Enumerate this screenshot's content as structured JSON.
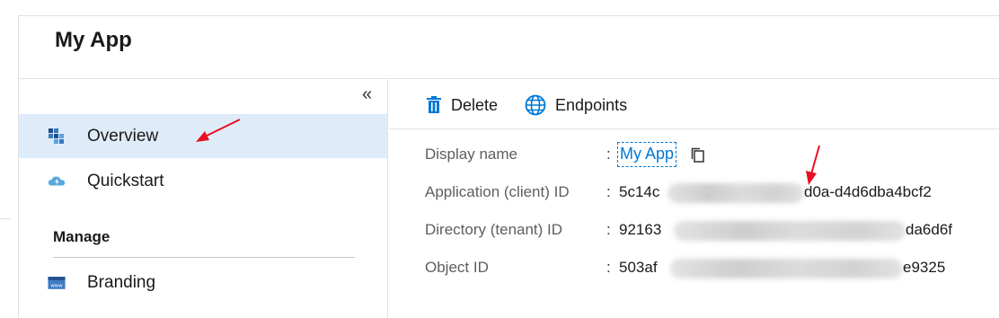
{
  "header": {
    "title": "My App"
  },
  "sidebar": {
    "collapse_glyph": "«",
    "items": [
      {
        "label": "Overview",
        "icon": "grid-cube-icon",
        "selected": true
      },
      {
        "label": "Quickstart",
        "icon": "cloud-lightning-icon",
        "selected": false
      }
    ],
    "manage_section": {
      "title": "Manage",
      "items": [
        {
          "label": "Branding",
          "icon": "www-window-icon"
        }
      ]
    }
  },
  "toolbar": {
    "delete_label": "Delete",
    "endpoints_label": "Endpoints"
  },
  "properties": [
    {
      "key": "Display name",
      "value": "My App",
      "link": true
    },
    {
      "key": "Application (client) ID",
      "value_start": "5c14c",
      "value_end": "d0a-d4d6dba4bcf2"
    },
    {
      "key": "Directory (tenant) ID",
      "value_start": "92163",
      "value_end": "da6d6f"
    },
    {
      "key": "Object ID",
      "value_start": "503af",
      "value_end": "e9325"
    }
  ],
  "colors": {
    "accent": "#0078d4",
    "selected_bg": "#deecf9",
    "annotation_arrow": "#e81123"
  }
}
